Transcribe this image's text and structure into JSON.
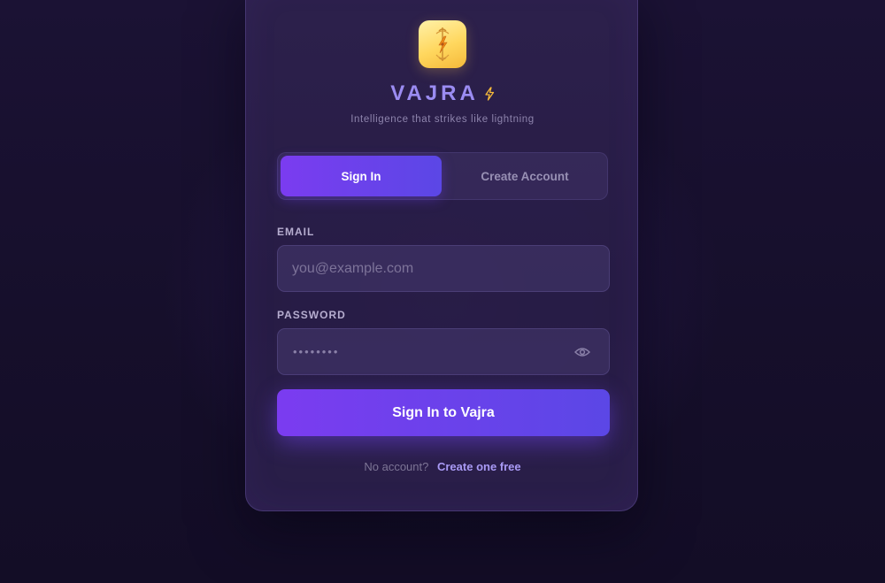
{
  "brand": {
    "name": "VAJRA",
    "tagline": "Intelligence that strikes like lightning",
    "logo_icon": "vajra-lightning-icon",
    "accent_color": "#9b8cf2",
    "logo_color": "#ffd75e"
  },
  "tabs": [
    {
      "label": "Sign In",
      "active": true
    },
    {
      "label": "Create Account",
      "active": false
    }
  ],
  "form": {
    "email": {
      "label": "EMAIL",
      "placeholder": "you@example.com",
      "value": ""
    },
    "password": {
      "label": "PASSWORD",
      "masked_value": "••••••••",
      "toggle_icon": "eye-icon"
    },
    "submit_label": "Sign In to Vajra"
  },
  "footer": {
    "prompt": "No account?",
    "link_label": "Create one free"
  },
  "colors": {
    "primary_gradient_start": "#7b3cf0",
    "primary_gradient_end": "#5b47e6"
  }
}
